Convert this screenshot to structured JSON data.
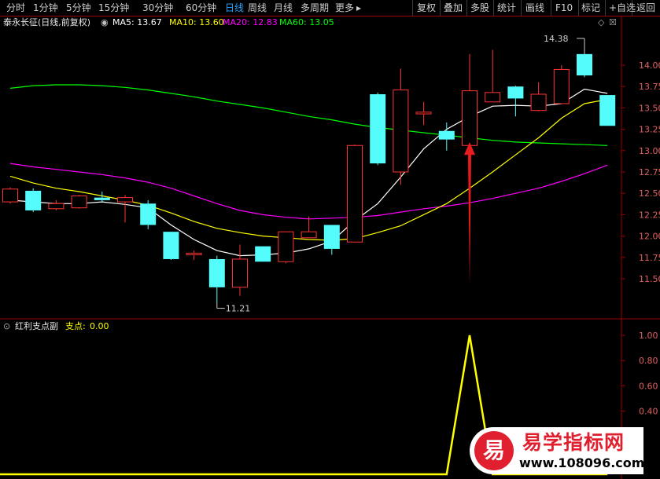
{
  "toolbar": {
    "left": [
      {
        "label": "分时",
        "active": false
      },
      {
        "label": "1分钟",
        "active": false
      },
      {
        "label": "5分钟",
        "active": false
      },
      {
        "label": "15分钟",
        "active": false
      },
      {
        "label": "30分钟",
        "active": false
      },
      {
        "label": "60分钟",
        "active": false
      },
      {
        "label": "日线",
        "active": true
      },
      {
        "label": "周线",
        "active": false
      },
      {
        "label": "月线",
        "active": false
      },
      {
        "label": "多周期",
        "active": false
      },
      {
        "label": "更多",
        "active": false
      }
    ],
    "right": [
      "复权",
      "叠加",
      "多股",
      "统计",
      "画线",
      "F10",
      "标记",
      "+自选",
      "返回"
    ]
  },
  "main_info": {
    "stock_name": "泰永长征(日线,前复权)",
    "ma5": "MA5: 13.67",
    "ma10": "MA10: 13.60",
    "ma20": "MA20: 12.83",
    "ma60": "MA60: 13.05"
  },
  "sub_info": {
    "indicator_name": "红利支点副",
    "label": "支点:",
    "value": "0.00"
  },
  "colors": {
    "up": "#ff3333",
    "down": "#54fcfc",
    "ma5": "#ffffff",
    "ma10": "#ffff00",
    "ma20": "#ff00ff",
    "ma60": "#00ff00",
    "axis": "#a00000",
    "indicator": "#ffff00"
  },
  "chart_data": [
    {
      "type": "candlestick",
      "title": "泰永长征(日线,前复权)",
      "ylim": [
        11.2,
        14.5
      ],
      "yticks": [
        "14.00",
        "13.75",
        "13.50",
        "13.25",
        "13.00",
        "12.75",
        "12.50",
        "12.25",
        "12.00",
        "11.75",
        "11.50"
      ],
      "high_label": "14.38",
      "low_label": "11.21",
      "candles": [
        {
          "o": 12.4,
          "h": 12.57,
          "l": 12.38,
          "c": 12.55
        },
        {
          "o": 12.53,
          "h": 12.56,
          "l": 12.28,
          "c": 12.3
        },
        {
          "o": 12.32,
          "h": 12.42,
          "l": 12.3,
          "c": 12.38
        },
        {
          "o": 12.33,
          "h": 12.48,
          "l": 12.32,
          "c": 12.47
        },
        {
          "o": 12.45,
          "h": 12.52,
          "l": 12.4,
          "c": 12.42
        },
        {
          "o": 12.4,
          "h": 12.48,
          "l": 12.16,
          "c": 12.45
        },
        {
          "o": 12.38,
          "h": 12.42,
          "l": 12.08,
          "c": 12.13
        },
        {
          "o": 12.05,
          "h": 12.05,
          "l": 11.72,
          "c": 11.73
        },
        {
          "o": 11.78,
          "h": 11.83,
          "l": 11.72,
          "c": 11.8
        },
        {
          "o": 11.73,
          "h": 11.77,
          "l": 11.21,
          "c": 11.4
        },
        {
          "o": 11.4,
          "h": 11.9,
          "l": 11.3,
          "c": 11.73
        },
        {
          "o": 11.88,
          "h": 11.88,
          "l": 11.7,
          "c": 11.7
        },
        {
          "o": 11.7,
          "h": 12.05,
          "l": 11.68,
          "c": 12.05
        },
        {
          "o": 11.98,
          "h": 12.23,
          "l": 11.98,
          "c": 12.05
        },
        {
          "o": 12.13,
          "h": 12.13,
          "l": 11.78,
          "c": 11.85
        },
        {
          "o": 11.93,
          "h": 13.07,
          "l": 11.93,
          "c": 13.06
        },
        {
          "o": 13.66,
          "h": 13.68,
          "l": 12.83,
          "c": 12.85
        },
        {
          "o": 12.75,
          "h": 13.96,
          "l": 12.6,
          "c": 13.71
        },
        {
          "o": 13.43,
          "h": 13.57,
          "l": 13.3,
          "c": 13.45
        },
        {
          "o": 13.23,
          "h": 13.33,
          "l": 13.0,
          "c": 13.13
        },
        {
          "o": 13.06,
          "h": 14.13,
          "l": 13.05,
          "c": 13.7
        },
        {
          "o": 13.57,
          "h": 14.18,
          "l": 13.57,
          "c": 13.68
        },
        {
          "o": 13.75,
          "h": 13.76,
          "l": 13.4,
          "c": 13.61
        },
        {
          "o": 13.47,
          "h": 13.8,
          "l": 13.46,
          "c": 13.66
        },
        {
          "o": 13.55,
          "h": 14.0,
          "l": 13.55,
          "c": 13.95
        },
        {
          "o": 14.13,
          "h": 14.13,
          "l": 13.86,
          "c": 13.88
        },
        {
          "o": 13.65,
          "h": 13.65,
          "l": 13.29,
          "c": 13.29
        }
      ],
      "ma5": [
        12.42,
        12.4,
        12.38,
        12.38,
        12.4,
        12.37,
        12.33,
        12.13,
        11.96,
        11.83,
        11.77,
        11.78,
        11.8,
        11.85,
        11.94,
        12.18,
        12.38,
        12.69,
        13.02,
        13.25,
        13.4,
        13.52,
        13.53,
        13.52,
        13.55,
        13.72,
        13.67
      ],
      "ma10": [
        12.7,
        12.62,
        12.56,
        12.52,
        12.47,
        12.42,
        12.36,
        12.27,
        12.17,
        12.09,
        12.04,
        12.0,
        11.98,
        11.96,
        11.95,
        11.97,
        12.04,
        12.12,
        12.25,
        12.38,
        12.56,
        12.75,
        12.95,
        13.15,
        13.38,
        13.55,
        13.6
      ],
      "ma20": [
        12.85,
        12.81,
        12.78,
        12.75,
        12.72,
        12.68,
        12.63,
        12.56,
        12.47,
        12.38,
        12.3,
        12.25,
        12.22,
        12.2,
        12.21,
        12.22,
        12.24,
        12.28,
        12.32,
        12.35,
        12.39,
        12.44,
        12.5,
        12.56,
        12.64,
        12.73,
        12.83
      ],
      "ma60": [
        13.73,
        13.76,
        13.77,
        13.77,
        13.76,
        13.74,
        13.71,
        13.67,
        13.63,
        13.58,
        13.54,
        13.5,
        13.45,
        13.4,
        13.36,
        13.31,
        13.27,
        13.24,
        13.21,
        13.18,
        13.15,
        13.12,
        13.1,
        13.09,
        13.08,
        13.07,
        13.06
      ]
    },
    {
      "type": "line",
      "title": "红利支点副",
      "series": [
        {
          "name": "支点",
          "values": [
            0,
            0,
            0,
            0,
            0,
            0,
            0,
            0,
            0,
            0,
            0,
            0,
            0,
            0,
            0,
            0,
            0,
            0,
            0,
            0,
            1,
            0,
            0,
            0,
            0,
            0,
            0
          ]
        }
      ],
      "yticks": [
        "1.00",
        "0.80",
        "0.60",
        "0.40"
      ],
      "ylim": [
        0,
        1.0
      ]
    }
  ],
  "watermark": {
    "glyph": "易",
    "name": "易学指标网",
    "url": "www.108096.com"
  }
}
